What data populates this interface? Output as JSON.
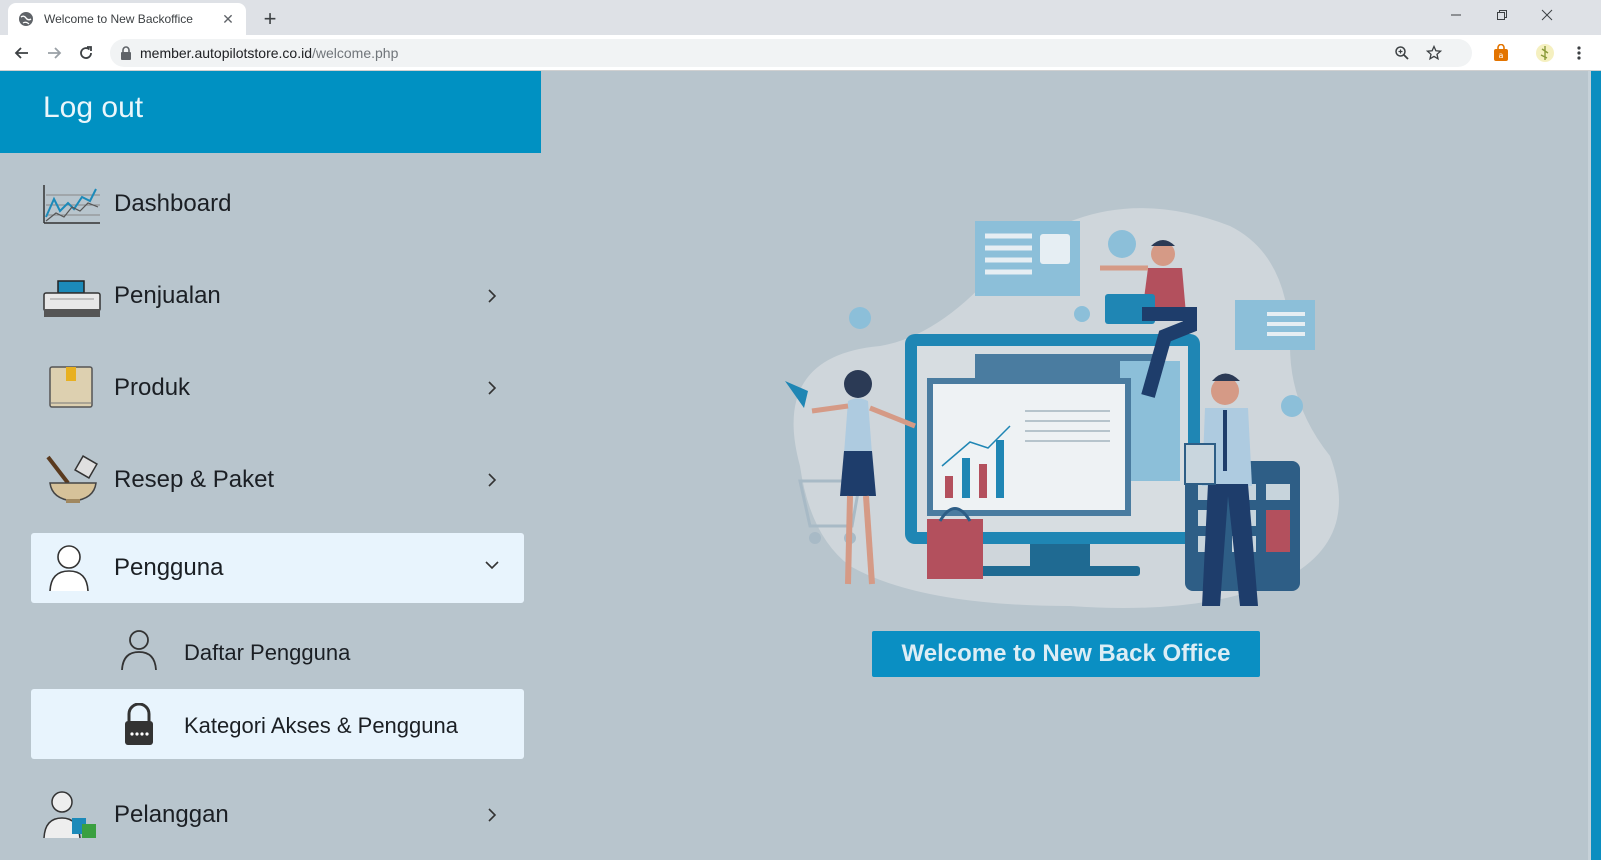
{
  "browser": {
    "tab_title": "Welcome to New Backoffice",
    "url_host": "member.autopilotstore.co.id",
    "url_path": "/welcome.php"
  },
  "sidebar": {
    "header": "Log out",
    "items": [
      {
        "label": "Dashboard",
        "icon": "chart-icon",
        "has_chevron": false
      },
      {
        "label": "Penjualan",
        "icon": "cash-register-icon",
        "has_chevron": true
      },
      {
        "label": "Produk",
        "icon": "box-icon",
        "has_chevron": true
      },
      {
        "label": "Resep & Paket",
        "icon": "mortar-pestle-icon",
        "has_chevron": true
      },
      {
        "label": "Pengguna",
        "icon": "user-icon",
        "has_chevron": true,
        "expanded": true
      },
      {
        "label": "Pelanggan",
        "icon": "customer-icon",
        "has_chevron": true
      }
    ],
    "sub_items": [
      {
        "label": "Daftar Pengguna",
        "icon": "user-outline-icon"
      },
      {
        "label": "Kategori Akses & Pengguna",
        "icon": "lock-icon",
        "selected": true
      }
    ]
  },
  "main": {
    "welcome_label": "Welcome to New Back Office"
  },
  "colors": {
    "accent": "#0091c2",
    "page_bg": "#b8c5cd",
    "active_bg": "#e8f4fd"
  }
}
